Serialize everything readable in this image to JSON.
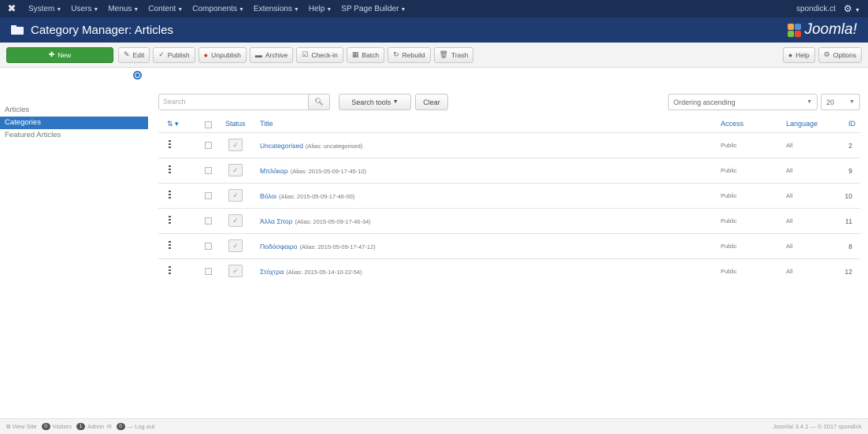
{
  "topbar": {
    "logo": "✖",
    "menus": [
      "System",
      "Users",
      "Menus",
      "Content",
      "Components",
      "Extensions",
      "Help",
      "SP Page Builder"
    ],
    "user": "spondick.ct",
    "settings_icon": "gear-icon"
  },
  "header": {
    "title": "Category Manager: Articles",
    "brand": "Joomla!",
    "brand_colors": [
      "#f9a541",
      "#5091cd",
      "#7ac143",
      "#f44321"
    ]
  },
  "toolbar": {
    "new": "New",
    "edit": "Edit",
    "publish": "Publish",
    "unpublish": "Unpublish",
    "archive": "Archive",
    "checkin": "Check-in",
    "batch": "Batch",
    "rebuild": "Rebuild",
    "trash": "Trash",
    "help": "Help",
    "options": "Options"
  },
  "sidebar": {
    "items": [
      "Articles",
      "Categories",
      "Featured Articles"
    ],
    "active_index": 1
  },
  "filters": {
    "search_placeholder": "Search",
    "search_tools": "Search tools",
    "clear": "Clear",
    "ordering": "Ordering ascending",
    "limit": "20"
  },
  "table": {
    "headers": {
      "status": "Status",
      "title": "Title",
      "access": "Access",
      "language": "Language",
      "id": "ID"
    },
    "rows": [
      {
        "title": "Uncategorised",
        "alias": "(Alias: uncategorised)",
        "access": "Public",
        "language": "All",
        "id": "2"
      },
      {
        "title": "Μπλόκαρ",
        "alias": "(Alias: 2015-05-09-17-45-10)",
        "access": "Public",
        "language": "All",
        "id": "9"
      },
      {
        "title": "Βόλοι",
        "alias": "(Alias: 2015-05-09-17-46-00)",
        "access": "Public",
        "language": "All",
        "id": "10"
      },
      {
        "title": "Άλλα Σπορ",
        "alias": "(Alias: 2015-05-09-17-46-34)",
        "access": "Public",
        "language": "All",
        "id": "11"
      },
      {
        "title": "Ποδόσφαιρο",
        "alias": "(Alias: 2015-05-09-17-47-12)",
        "access": "Public",
        "language": "All",
        "id": "8"
      },
      {
        "title": "Στόχτρα",
        "alias": "(Alias: 2015-05-14-10-22-54)",
        "access": "Public",
        "language": "All",
        "id": "12"
      }
    ]
  },
  "footer": {
    "view_site": "View Site",
    "visitors_count": "0",
    "visitors": "Visitors",
    "admin_count": "1",
    "admin": "Admin",
    "messages_count": "0",
    "logout": "Log out",
    "version": "Joomla! 3.4.1 — © 2017 spondick"
  }
}
